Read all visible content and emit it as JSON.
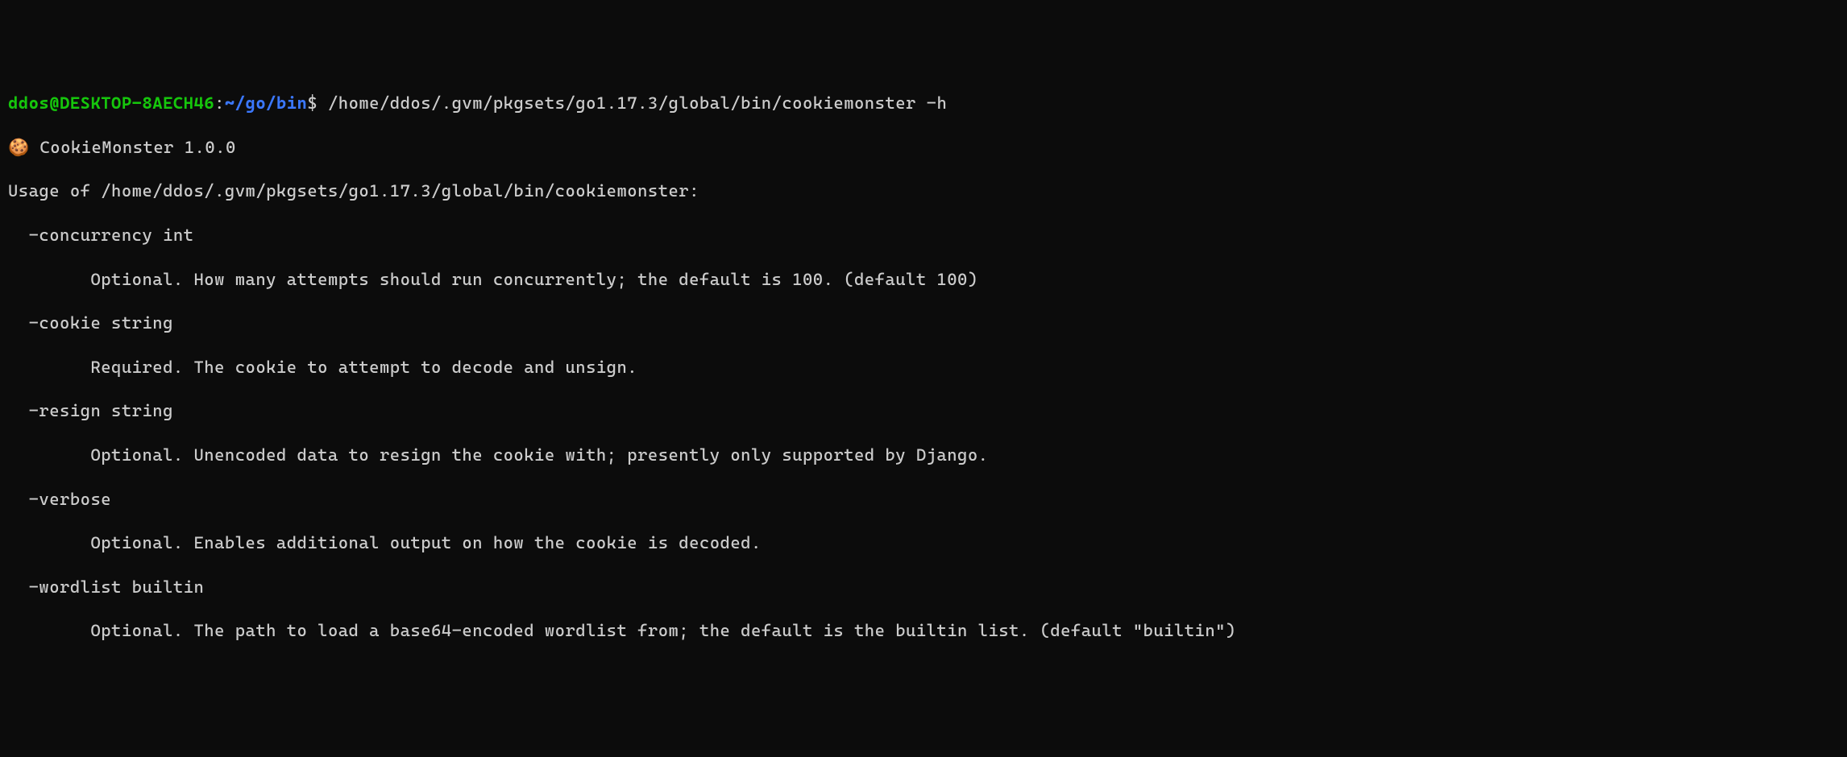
{
  "prompt": {
    "user_host": "ddos@DESKTOP-8AECH46",
    "separator": ":",
    "path": "~/go/bin",
    "dollar": "$",
    "command": " /home/ddos/.gvm/pkgsets/go1.17.3/global/bin/cookiemonster -h"
  },
  "banner": {
    "icon": "🍪",
    "text": " CookieMonster 1.0.0"
  },
  "usage_line": "Usage of /home/ddos/.gvm/pkgsets/go1.17.3/global/bin/cookiemonster:",
  "flags": [
    {
      "name": "  -concurrency int",
      "desc": "        Optional. How many attempts should run concurrently; the default is 100. (default 100)"
    },
    {
      "name": "  -cookie string",
      "desc": "        Required. The cookie to attempt to decode and unsign."
    },
    {
      "name": "  -resign string",
      "desc": "        Optional. Unencoded data to resign the cookie with; presently only supported by Django."
    },
    {
      "name": "  -verbose",
      "desc": "        Optional. Enables additional output on how the cookie is decoded."
    },
    {
      "name": "  -wordlist builtin",
      "desc": "        Optional. The path to load a base64-encoded wordlist from; the default is the builtin list. (default \"builtin\")"
    }
  ]
}
